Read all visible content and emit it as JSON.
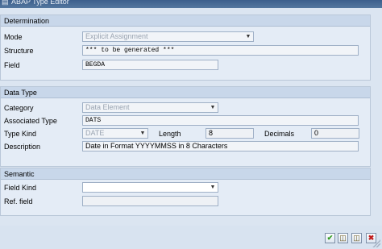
{
  "window": {
    "title": "ABAP Type Editor"
  },
  "determination": {
    "header": "Determination",
    "mode_label": "Mode",
    "mode_value": "Explicit Assignment",
    "structure_label": "Structure",
    "structure_value": "*** to be generated ***",
    "field_label": "Field",
    "field_value": "BEGDA"
  },
  "data_type": {
    "header": "Data Type",
    "category_label": "Category",
    "category_value": "Data Element",
    "associated_type_label": "Associated Type",
    "associated_type_value": "DATS",
    "type_kind_label": "Type Kind",
    "type_kind_value": "DATE",
    "length_label": "Length",
    "length_value": "8",
    "decimals_label": "Decimals",
    "decimals_value": "0",
    "description_label": "Description",
    "description_value": "Date in Format YYYYMMSS in 8 Characters"
  },
  "semantic": {
    "header": "Semantic",
    "field_kind_label": "Field Kind",
    "field_kind_value": "",
    "ref_field_label": "Ref. field",
    "ref_field_value": ""
  },
  "icons": {
    "window": "abap-window-icon",
    "dropdown": "chevron-down-icon",
    "ok": "checkmark-icon",
    "save1": "save-local-icon",
    "save2": "save-transport-icon",
    "cancel": "close-icon"
  },
  "colors": {
    "titlebar": "#3c5f8c",
    "background": "#dbe5f1",
    "group_header": "#c8d7ea",
    "ok_green": "#2e9a1c",
    "cancel_red": "#c21e1e"
  }
}
